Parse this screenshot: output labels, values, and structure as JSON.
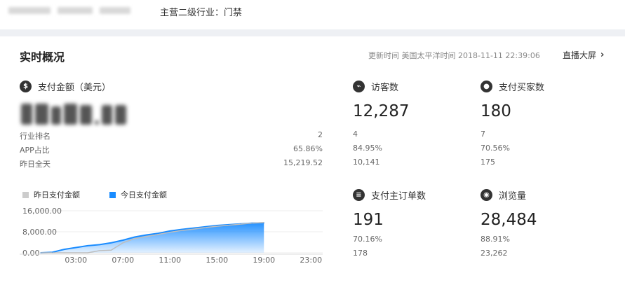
{
  "header": {
    "industry_text": "主营二级行业：门禁"
  },
  "panel": {
    "title": "实时概况",
    "update_label": "更新时间 美国太平洋时间 2018-11-11 22:39:06",
    "live_link": "直播大屏",
    "live_chevron": "›"
  },
  "payment": {
    "label": "支付金额（美元）",
    "icon": "dollar-icon",
    "rows": [
      {
        "label": "行业排名",
        "value": "2"
      },
      {
        "label": "APP占比",
        "value": "65.86%"
      },
      {
        "label": "昨日全天",
        "value": "15,219.52"
      }
    ]
  },
  "metrics": [
    {
      "key": "visitors",
      "label": "访客数",
      "icon": "footprint-icon",
      "value": "12,287",
      "line1": "4",
      "line2": "84.95%",
      "line3": "10,141"
    },
    {
      "key": "buyers",
      "label": "支付买家数",
      "icon": "users-icon",
      "value": "180",
      "line1": "7",
      "line2": "70.56%",
      "line3": "175"
    },
    {
      "key": "orders",
      "label": "支付主订单数",
      "icon": "order-icon",
      "value": "191",
      "line1": "70.16%",
      "line2": "178"
    },
    {
      "key": "pageviews",
      "label": "浏览量",
      "icon": "eye-icon",
      "value": "28,484",
      "line1": "88.91%",
      "line2": "23,262"
    }
  ],
  "legend": {
    "yesterday": "昨日支付金额",
    "today": "今日支付金额"
  },
  "colors": {
    "today": "#1a8cff",
    "yesterday": "#cccccc",
    "band": "#eef0f4"
  },
  "chart_data": {
    "type": "area",
    "x_tick_labels": [
      "03:00",
      "07:00",
      "11:00",
      "15:00",
      "19:00",
      "23:00"
    ],
    "y_tick_labels": [
      "16,000.00",
      "8,000.00",
      "0.00"
    ],
    "ylim": [
      0,
      16000
    ],
    "xlim": [
      0,
      24
    ],
    "grid": true,
    "legend_position": "top-left",
    "series": [
      {
        "name": "昨日支付金额",
        "x": [
          0,
          1,
          2,
          3,
          4,
          5,
          6,
          7,
          8,
          9,
          10,
          11,
          12,
          13,
          14,
          15,
          16,
          17,
          18,
          19
        ],
        "values": [
          0,
          0,
          0,
          0,
          0,
          800,
          1000,
          3800,
          5400,
          6200,
          7000,
          7800,
          8500,
          9000,
          9600,
          10100,
          10500,
          10900,
          11300,
          11500
        ]
      },
      {
        "name": "今日支付金额",
        "x": [
          0,
          1,
          2,
          3,
          4,
          5,
          6,
          7,
          8,
          9,
          10,
          11,
          12,
          13,
          14,
          15,
          16,
          17,
          18,
          19
        ],
        "values": [
          0,
          200,
          1300,
          2000,
          2700,
          3100,
          3800,
          4800,
          6000,
          6800,
          7400,
          8300,
          8900,
          9400,
          9900,
          10400,
          10700,
          11000,
          11300,
          11400
        ]
      }
    ]
  }
}
